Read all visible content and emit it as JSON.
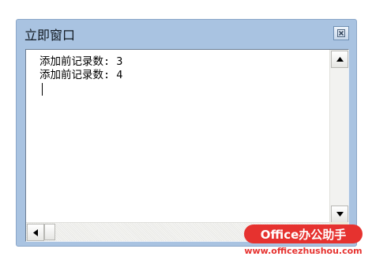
{
  "window": {
    "title": "立即窗口",
    "close_icon": "close-icon"
  },
  "output": {
    "lines": [
      "添加前记录数: 3",
      "添加前记录数: 4"
    ]
  },
  "scrollbars": {
    "up_icon": "arrow-up-icon",
    "down_icon": "arrow-down-icon",
    "left_icon": "arrow-left-icon"
  },
  "watermark": {
    "brand": "Office办公助手",
    "url": "www.officezhushou.com"
  },
  "colors": {
    "frame": "#a9c3e1",
    "brand_red": "#e6322f"
  }
}
